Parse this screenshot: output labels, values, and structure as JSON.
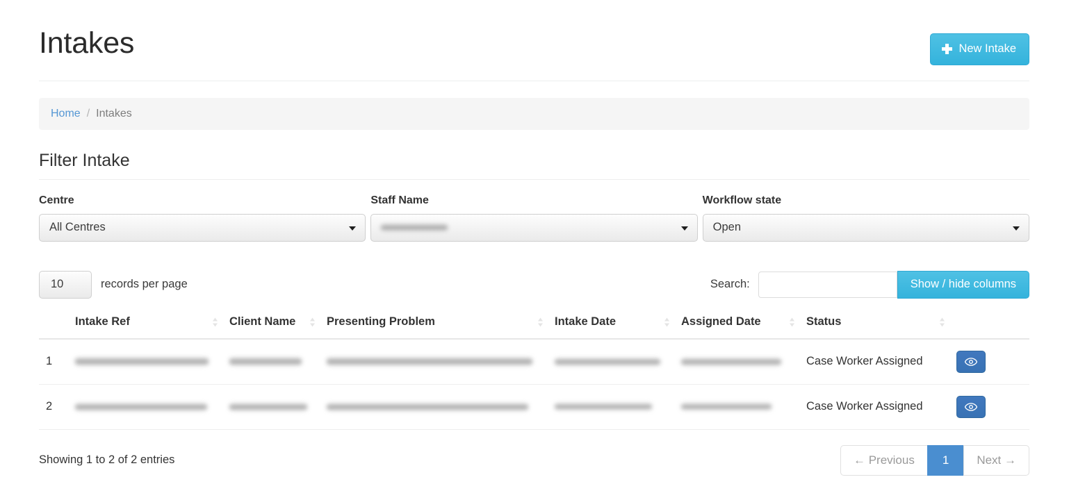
{
  "header": {
    "title": "Intakes",
    "new_intake_label": "New Intake",
    "plus_icon": "plus-icon",
    "accent_color": "#3cb8de"
  },
  "breadcrumb": {
    "home_label": "Home",
    "separator": "/",
    "current_label": "Intakes"
  },
  "filter": {
    "section_title": "Filter Intake",
    "fields": [
      {
        "label": "Centre",
        "value": "All Centres",
        "redacted": false
      },
      {
        "label": "Staff Name",
        "value": "",
        "redacted": true
      },
      {
        "label": "Workflow state",
        "value": "Open",
        "redacted": false
      }
    ]
  },
  "controls": {
    "per_page_value": "10",
    "per_page_label": "records per page",
    "search_label": "Search:",
    "search_value": "",
    "search_placeholder": "",
    "show_hide_columns_label": "Show / hide columns"
  },
  "table": {
    "columns": [
      {
        "label": "",
        "sortable": false
      },
      {
        "label": "Intake Ref",
        "sortable": true
      },
      {
        "label": "Client Name",
        "sortable": true
      },
      {
        "label": "Presenting Problem",
        "sortable": true
      },
      {
        "label": "Intake Date",
        "sortable": true
      },
      {
        "label": "Assigned Date",
        "sortable": true
      },
      {
        "label": "Status",
        "sortable": true
      },
      {
        "label": "",
        "sortable": false
      }
    ],
    "rows": [
      {
        "index": "1",
        "intake_ref": "",
        "client_name": "",
        "presenting_problem": "",
        "intake_date": "",
        "assigned_date": "",
        "status": "Case Worker Assigned",
        "action_icon": "eye-icon",
        "redacted": true
      },
      {
        "index": "2",
        "intake_ref": "",
        "client_name": "",
        "presenting_problem": "",
        "intake_date": "",
        "assigned_date": "",
        "status": "Case Worker Assigned",
        "action_icon": "eye-icon",
        "redacted": true
      }
    ]
  },
  "footer": {
    "entries_info": "Showing 1 to 2 of 2 entries",
    "previous_label": "← Previous",
    "page_number": "1",
    "next_label": "Next →",
    "active_page_color": "#4a8ed0"
  }
}
